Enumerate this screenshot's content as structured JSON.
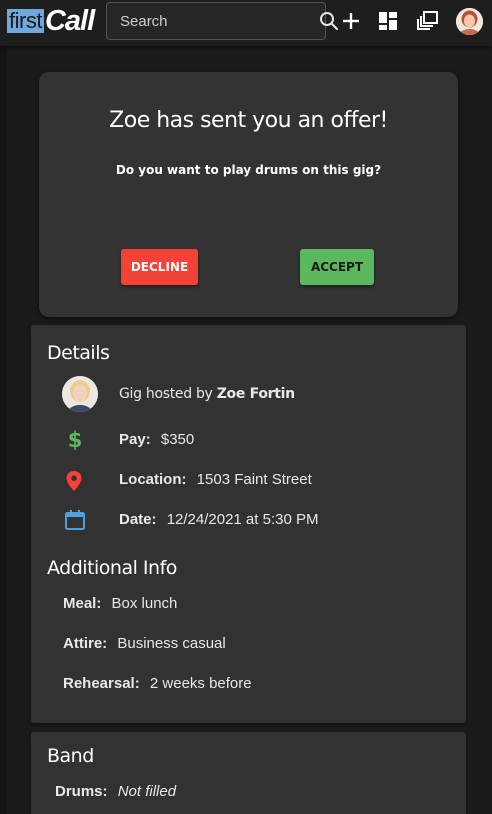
{
  "app": {
    "logo_first": "first",
    "logo_call": "Call"
  },
  "search": {
    "placeholder": "Search"
  },
  "offer": {
    "title": "Zoe has sent you an offer!",
    "question": "Do you want to play drums on this gig?",
    "decline_label": "DECLINE",
    "accept_label": "ACCEPT"
  },
  "details": {
    "heading": "Details",
    "host_prefix": "Gig hosted by",
    "host_name": "Zoe Fortin",
    "pay_label": "Pay:",
    "pay_value": "$350",
    "location_label": "Location:",
    "location_value": "1503 Faint Street",
    "date_label": "Date:",
    "date_value": "12/24/2021 at 5:30 PM"
  },
  "additional": {
    "heading": "Additional Info",
    "meal_label": "Meal:",
    "meal_value": "Box lunch",
    "attire_label": "Attire:",
    "attire_value": "Business casual",
    "rehearsal_label": "Rehearsal:",
    "rehearsal_value": "2 weeks before"
  },
  "band": {
    "heading": "Band",
    "drums_label": "Drums:",
    "drums_value": "Not filled"
  },
  "colors": {
    "decline": "#f44336",
    "accept": "#5cb85c",
    "pay_icon": "#5cb85c",
    "location_icon": "#f44336",
    "date_icon": "#4aa3df",
    "logo_accent": "#6fa8dc"
  },
  "icons": {
    "search": "search-icon",
    "add": "plus-icon",
    "dashboard": "dashboard-icon",
    "library": "library-icon",
    "pay": "dollar-icon",
    "location": "map-pin-icon",
    "date": "calendar-icon"
  }
}
